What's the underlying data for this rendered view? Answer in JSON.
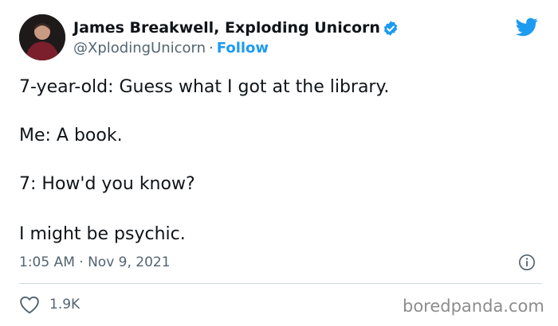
{
  "tweet": {
    "author_name": "James Breakwell, Exploding Unicorn",
    "handle": "@XplodingUnicorn",
    "separator": "·",
    "follow_label": "Follow",
    "lines": [
      "7-year-old: Guess what I got at the library.",
      "Me: A book.",
      "7: How'd you know?",
      "I might be psychic."
    ],
    "timestamp": "1:05 AM · Nov 9, 2021",
    "like_count": "1.9K"
  },
  "watermark": "boredpanda.com",
  "icons": {
    "verified": "verified-badge-icon",
    "brand": "twitter-bird-icon",
    "info": "info-icon",
    "like": "heart-icon"
  },
  "colors": {
    "accent": "#1d9bf0",
    "text": "#0f1419",
    "muted": "#536471",
    "divider": "#cfd9de"
  }
}
